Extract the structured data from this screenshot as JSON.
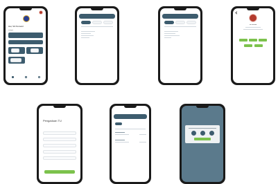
{
  "screens": {
    "home": {
      "greeting": "Hai, Siti Nursaid",
      "section_label": "Kategori",
      "colors": {
        "logo": "#2b3f8f",
        "avatar": "#b33b2e",
        "card": "#3d5c6e"
      }
    },
    "login": {
      "title": "Pengaduan TU",
      "submit_color": "#7cc24c"
    },
    "profile": {
      "name": "Siti Nursaid"
    },
    "dialog": {
      "overlay_color": "#5b7a8c",
      "confirm_color": "#7cc24c"
    }
  }
}
